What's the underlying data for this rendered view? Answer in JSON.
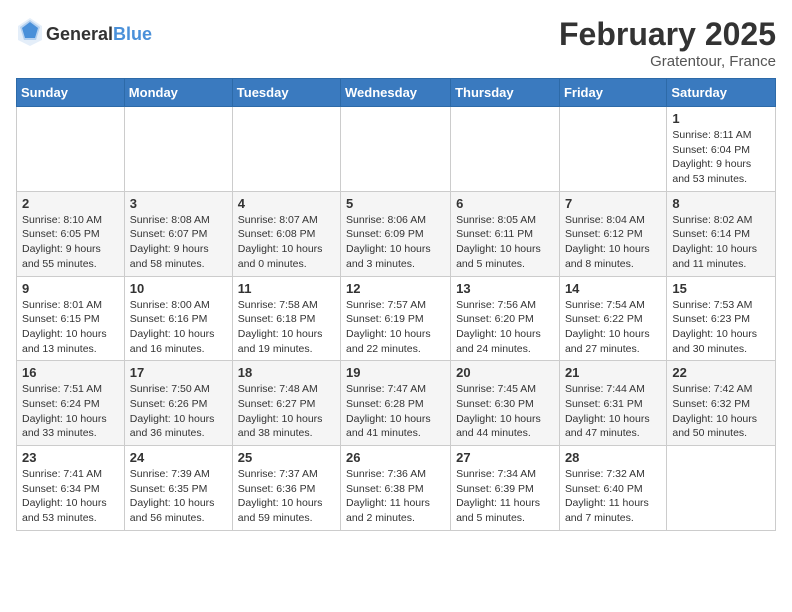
{
  "header": {
    "logo": {
      "text_general": "General",
      "text_blue": "Blue"
    },
    "title": "February 2025",
    "subtitle": "Gratentour, France"
  },
  "calendar": {
    "weekdays": [
      "Sunday",
      "Monday",
      "Tuesday",
      "Wednesday",
      "Thursday",
      "Friday",
      "Saturday"
    ],
    "rows": [
      [
        {
          "day": "",
          "info": ""
        },
        {
          "day": "",
          "info": ""
        },
        {
          "day": "",
          "info": ""
        },
        {
          "day": "",
          "info": ""
        },
        {
          "day": "",
          "info": ""
        },
        {
          "day": "",
          "info": ""
        },
        {
          "day": "1",
          "info": "Sunrise: 8:11 AM\nSunset: 6:04 PM\nDaylight: 9 hours and 53 minutes."
        }
      ],
      [
        {
          "day": "2",
          "info": "Sunrise: 8:10 AM\nSunset: 6:05 PM\nDaylight: 9 hours and 55 minutes."
        },
        {
          "day": "3",
          "info": "Sunrise: 8:08 AM\nSunset: 6:07 PM\nDaylight: 9 hours and 58 minutes."
        },
        {
          "day": "4",
          "info": "Sunrise: 8:07 AM\nSunset: 6:08 PM\nDaylight: 10 hours and 0 minutes."
        },
        {
          "day": "5",
          "info": "Sunrise: 8:06 AM\nSunset: 6:09 PM\nDaylight: 10 hours and 3 minutes."
        },
        {
          "day": "6",
          "info": "Sunrise: 8:05 AM\nSunset: 6:11 PM\nDaylight: 10 hours and 5 minutes."
        },
        {
          "day": "7",
          "info": "Sunrise: 8:04 AM\nSunset: 6:12 PM\nDaylight: 10 hours and 8 minutes."
        },
        {
          "day": "8",
          "info": "Sunrise: 8:02 AM\nSunset: 6:14 PM\nDaylight: 10 hours and 11 minutes."
        }
      ],
      [
        {
          "day": "9",
          "info": "Sunrise: 8:01 AM\nSunset: 6:15 PM\nDaylight: 10 hours and 13 minutes."
        },
        {
          "day": "10",
          "info": "Sunrise: 8:00 AM\nSunset: 6:16 PM\nDaylight: 10 hours and 16 minutes."
        },
        {
          "day": "11",
          "info": "Sunrise: 7:58 AM\nSunset: 6:18 PM\nDaylight: 10 hours and 19 minutes."
        },
        {
          "day": "12",
          "info": "Sunrise: 7:57 AM\nSunset: 6:19 PM\nDaylight: 10 hours and 22 minutes."
        },
        {
          "day": "13",
          "info": "Sunrise: 7:56 AM\nSunset: 6:20 PM\nDaylight: 10 hours and 24 minutes."
        },
        {
          "day": "14",
          "info": "Sunrise: 7:54 AM\nSunset: 6:22 PM\nDaylight: 10 hours and 27 minutes."
        },
        {
          "day": "15",
          "info": "Sunrise: 7:53 AM\nSunset: 6:23 PM\nDaylight: 10 hours and 30 minutes."
        }
      ],
      [
        {
          "day": "16",
          "info": "Sunrise: 7:51 AM\nSunset: 6:24 PM\nDaylight: 10 hours and 33 minutes."
        },
        {
          "day": "17",
          "info": "Sunrise: 7:50 AM\nSunset: 6:26 PM\nDaylight: 10 hours and 36 minutes."
        },
        {
          "day": "18",
          "info": "Sunrise: 7:48 AM\nSunset: 6:27 PM\nDaylight: 10 hours and 38 minutes."
        },
        {
          "day": "19",
          "info": "Sunrise: 7:47 AM\nSunset: 6:28 PM\nDaylight: 10 hours and 41 minutes."
        },
        {
          "day": "20",
          "info": "Sunrise: 7:45 AM\nSunset: 6:30 PM\nDaylight: 10 hours and 44 minutes."
        },
        {
          "day": "21",
          "info": "Sunrise: 7:44 AM\nSunset: 6:31 PM\nDaylight: 10 hours and 47 minutes."
        },
        {
          "day": "22",
          "info": "Sunrise: 7:42 AM\nSunset: 6:32 PM\nDaylight: 10 hours and 50 minutes."
        }
      ],
      [
        {
          "day": "23",
          "info": "Sunrise: 7:41 AM\nSunset: 6:34 PM\nDaylight: 10 hours and 53 minutes."
        },
        {
          "day": "24",
          "info": "Sunrise: 7:39 AM\nSunset: 6:35 PM\nDaylight: 10 hours and 56 minutes."
        },
        {
          "day": "25",
          "info": "Sunrise: 7:37 AM\nSunset: 6:36 PM\nDaylight: 10 hours and 59 minutes."
        },
        {
          "day": "26",
          "info": "Sunrise: 7:36 AM\nSunset: 6:38 PM\nDaylight: 11 hours and 2 minutes."
        },
        {
          "day": "27",
          "info": "Sunrise: 7:34 AM\nSunset: 6:39 PM\nDaylight: 11 hours and 5 minutes."
        },
        {
          "day": "28",
          "info": "Sunrise: 7:32 AM\nSunset: 6:40 PM\nDaylight: 11 hours and 7 minutes."
        },
        {
          "day": "",
          "info": ""
        }
      ]
    ]
  }
}
